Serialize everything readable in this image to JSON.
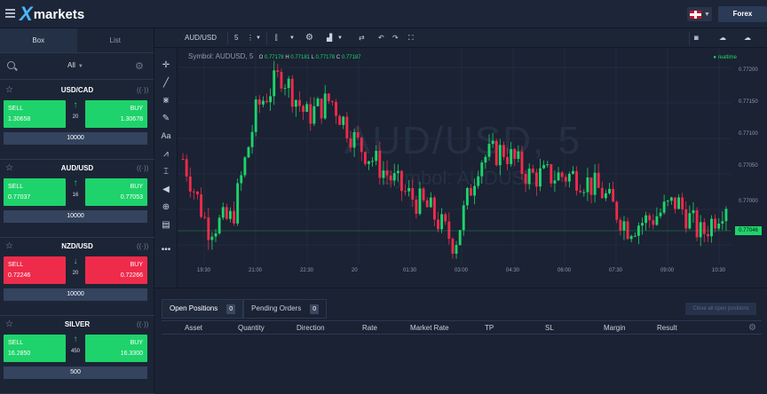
{
  "app": {
    "brand_x": "X",
    "brand_name": "markets",
    "account_button": "Forex"
  },
  "panel": {
    "tabs": [
      "Box",
      "List"
    ],
    "filter": "All",
    "instruments": [
      {
        "symbol": "USD/CAD",
        "sell_label": "SELL",
        "sell_price": "1.30658",
        "buy_label": "BUY",
        "buy_price": "1.30678",
        "spread": "20",
        "quantity": "10000",
        "sell_color": "#1ed36b",
        "buy_color": "#1ed36b",
        "trend": "up"
      },
      {
        "symbol": "AUD/USD",
        "sell_label": "SELL",
        "sell_price": "0.77037",
        "buy_label": "BUY",
        "buy_price": "0.77053",
        "spread": "16",
        "quantity": "10000",
        "sell_color": "#1ed36b",
        "buy_color": "#1ed36b",
        "trend": "up"
      },
      {
        "symbol": "NZD/USD",
        "sell_label": "SELL",
        "sell_price": "0.72246",
        "buy_label": "BUY",
        "buy_price": "0.72266",
        "spread": "20",
        "quantity": "10000",
        "sell_color": "#ef2b4b",
        "buy_color": "#ef2b4b",
        "trend": "down"
      },
      {
        "symbol": "SILVER",
        "sell_label": "SELL",
        "sell_price": "16.2850",
        "buy_label": "BUY",
        "buy_price": "16.3300",
        "spread": "450",
        "quantity": "500",
        "sell_color": "#1ed36b",
        "buy_color": "#1ed36b",
        "trend": "up"
      }
    ]
  },
  "chart": {
    "symbol_select": "AUD/USD",
    "interval": "5",
    "legend_symbol": "Symbol: AUDUSD, 5",
    "open": "0.77178",
    "high": "0.77181",
    "low": "0.77178",
    "close": "0.77187",
    "realtime": "realtime",
    "watermark_main": "AUD/USD, 5",
    "watermark_sub": "Symbol: AUDUSD",
    "last_price": "0.77046",
    "y_ticks": [
      "0.77200",
      "0.77150",
      "0.77100",
      "0.77050",
      "0.77000"
    ],
    "x_ticks": [
      "19:30",
      "21:00",
      "22:30",
      "20",
      "01:30",
      "03:00",
      "04:30",
      "06:00",
      "07:30",
      "09:00",
      "10:30"
    ]
  },
  "chart_data": {
    "type": "candlestick",
    "title": "AUD/USD, 5",
    "x": [
      "19:30",
      "21:00",
      "22:30",
      "20",
      "01:30",
      "03:00",
      "04:30",
      "06:00",
      "07:30",
      "09:00",
      "10:30"
    ],
    "ylim": [
      0.7698,
      0.7722
    ],
    "close_series": [
      0.771,
      0.7702,
      0.7703,
      0.7716,
      0.772,
      0.7715,
      0.7717,
      0.7712,
      0.7709,
      0.7706,
      0.7704,
      0.77,
      0.771,
      0.7711,
      0.7708,
      0.7708,
      0.7708,
      0.7706,
      0.7702,
      0.7703,
      0.7705,
      0.7701,
      0.7705
    ]
  },
  "positions": {
    "tab_open": "Open Positions",
    "tab_open_count": "0",
    "tab_pending": "Pending Orders",
    "tab_pending_count": "0",
    "close_all": "Close all open positions",
    "columns": [
      "Asset",
      "Quantity",
      "Direction",
      "Rate",
      "Market Rate",
      "TP",
      "SL",
      "Margin",
      "Result"
    ]
  },
  "colors": {
    "up": "#1ed36b",
    "down": "#ef2b4b",
    "bg": "#1a2233"
  }
}
